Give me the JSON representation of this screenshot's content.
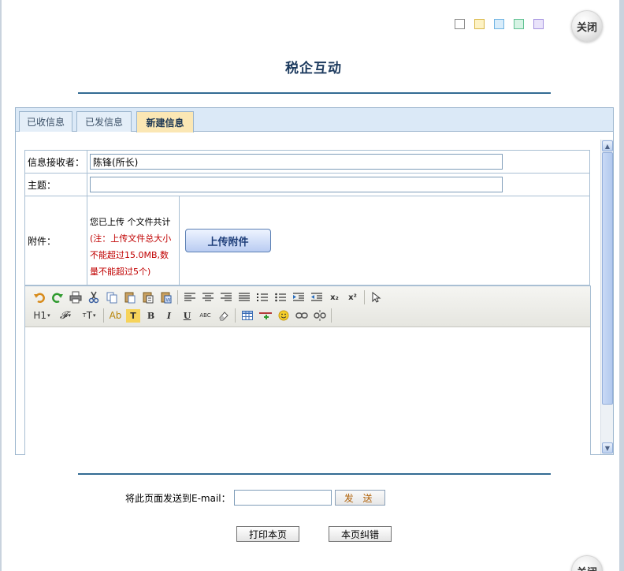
{
  "header": {
    "title": "税企互动",
    "close_label": "关闭",
    "theme_swatches": [
      "#ffffff",
      "#fdf2c4",
      "#d8ecfa",
      "#d6f3e4",
      "#e9e3fa"
    ]
  },
  "tabs": [
    {
      "label": "已收信息",
      "active": false
    },
    {
      "label": "已发信息",
      "active": false
    },
    {
      "label": "新建信息",
      "active": true
    }
  ],
  "form": {
    "recipient_label": "信息接收者：",
    "recipient_value": "陈锋(所长)",
    "subject_label": "主题：",
    "subject_value": "",
    "attachment_label": "附件：",
    "attachment_note_prefix": "您已上传 个文件共计",
    "attachment_note_warning": "(注：上传文件总大小不能超过15.0MB,数量不能超过5个)",
    "upload_button": "上传附件"
  },
  "editor": {
    "toolbar_row1": [
      "undo-icon",
      "redo-icon",
      "print-icon",
      "cut-icon",
      "copy-icon",
      "paste-icon",
      "paste-text-icon",
      "paste-word-icon",
      "align-left-icon",
      "align-center-icon",
      "align-right-icon",
      "justify-icon",
      "ordered-list-icon",
      "unordered-list-icon",
      "indent-icon",
      "outdent-icon",
      "subscript-icon",
      "superscript-icon",
      "select-icon"
    ],
    "toolbar_row2": [
      "heading-icon",
      "font-family-icon",
      "font-size-icon",
      "font-color-icon",
      "highlight-icon",
      "bold-icon",
      "italic-icon",
      "underline-icon",
      "strikethrough-icon",
      "eraser-icon",
      "table-icon",
      "horizontal-rule-icon",
      "emoticon-icon",
      "link-icon",
      "unlink-icon"
    ],
    "heading_label": "H1",
    "font_color_label": "Ab",
    "highlight_label": "T",
    "bold_label": "B",
    "italic_label": "I",
    "underline_label": "U",
    "strike_label": "ABC",
    "subscript_label": "x₂",
    "superscript_label": "x²",
    "content": ""
  },
  "email": {
    "label": "将此页面发送到E-mail：",
    "value": "",
    "send_button": "发 送"
  },
  "footer": {
    "print_button": "打印本页",
    "correct_button": "本页纠错"
  }
}
